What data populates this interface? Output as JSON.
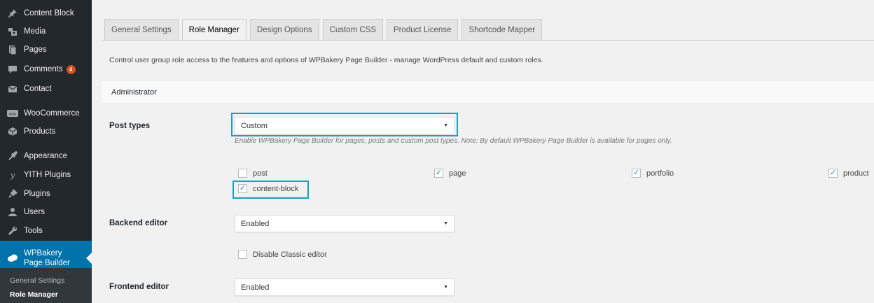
{
  "sidebar": {
    "items": [
      {
        "label": "Content Block",
        "icon": "pin-icon"
      },
      {
        "label": "Media",
        "icon": "media-icon"
      },
      {
        "label": "Pages",
        "icon": "pages-icon"
      },
      {
        "label": "Comments",
        "icon": "comments-icon",
        "badge": "4"
      },
      {
        "label": "Contact",
        "icon": "mail-icon"
      },
      {
        "label": "WooCommerce",
        "icon": "woo-icon"
      },
      {
        "label": "Products",
        "icon": "products-icon"
      },
      {
        "label": "Appearance",
        "icon": "appearance-icon"
      },
      {
        "label": "YITH Plugins",
        "icon": "yith-icon"
      },
      {
        "label": "Plugins",
        "icon": "plugins-icon"
      },
      {
        "label": "Users",
        "icon": "users-icon"
      },
      {
        "label": "Tools",
        "icon": "tools-icon"
      },
      {
        "label": "WPBakery Page Builder",
        "icon": "wpbakery-icon",
        "active": true
      }
    ],
    "submenu": [
      {
        "label": "General Settings"
      },
      {
        "label": "Role Manager",
        "current": true
      }
    ]
  },
  "tabs": [
    {
      "label": "General Settings"
    },
    {
      "label": "Role Manager",
      "active": true
    },
    {
      "label": "Design Options"
    },
    {
      "label": "Custom CSS"
    },
    {
      "label": "Product License"
    },
    {
      "label": "Shortcode Mapper"
    }
  ],
  "intro_text": "Control user group role access to the features and options of WPBakery Page Builder - manage WordPress default and custom roles.",
  "section_title": "Administrator",
  "post_types": {
    "label": "Post types",
    "selected": "Custom",
    "help": "Enable WPBakery Page Builder for pages, posts and custom post types. Note: By default WPBakery Page Builder is available for pages only.",
    "checkboxes": [
      {
        "label": "post",
        "checked": false
      },
      {
        "label": "page",
        "checked": true
      },
      {
        "label": "portfolio",
        "checked": true
      },
      {
        "label": "product",
        "checked": true
      },
      {
        "label": "content-block",
        "checked": true
      }
    ]
  },
  "backend_editor": {
    "label": "Backend editor",
    "selected": "Enabled",
    "disable_classic": {
      "label": "Disable Classic editor",
      "checked": false
    }
  },
  "frontend_editor": {
    "label": "Frontend editor",
    "selected": "Enabled"
  },
  "colors": {
    "sidebar_bg": "#23282d",
    "active_menu": "#0073aa",
    "highlight": "#1a9fbd",
    "badge": "#d54e21"
  }
}
